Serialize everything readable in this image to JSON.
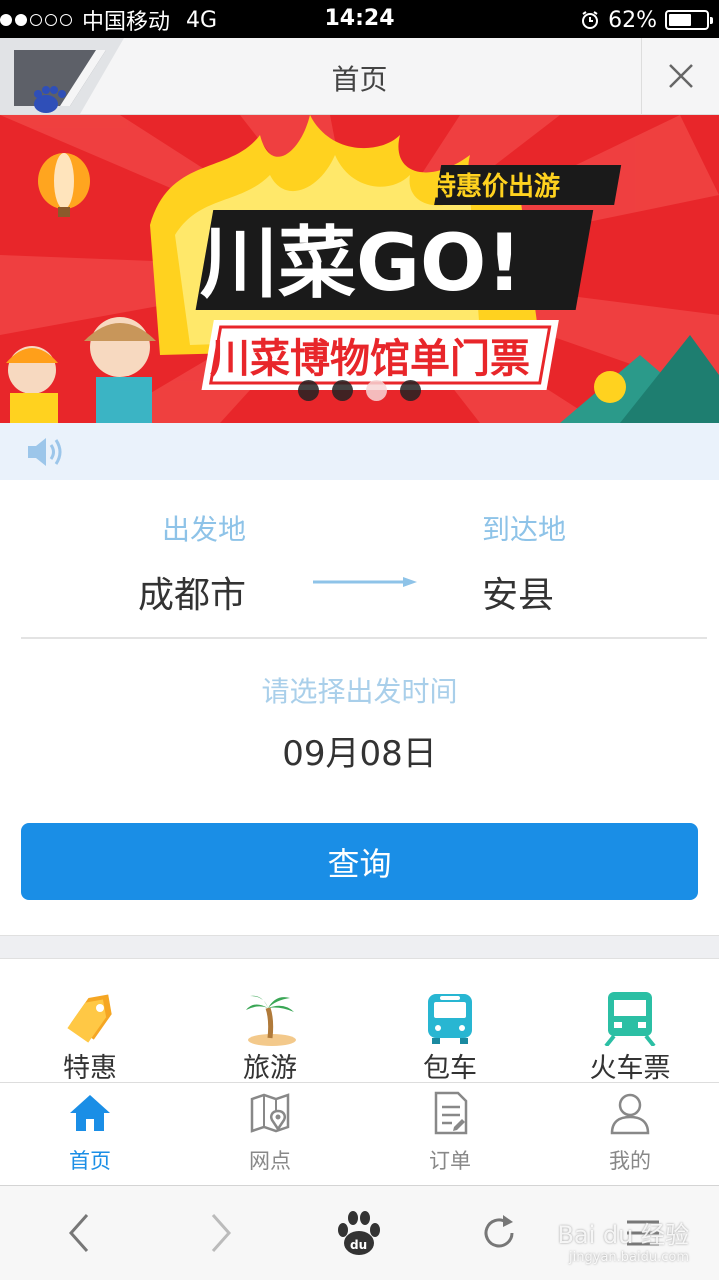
{
  "status_bar": {
    "carrier": "中国移动",
    "network": "4G",
    "time": "14:24",
    "battery": "62%",
    "battery_level": 0.62,
    "signal_bars": 2
  },
  "nav": {
    "title": "首页"
  },
  "banner": {
    "tagline": "特惠价出游",
    "headline": "川菜GO!",
    "subline": "川菜博物馆单门票",
    "slide_count": 4,
    "active_slide": 3
  },
  "search": {
    "from_label": "出发地",
    "from_city": "成都市",
    "to_label": "到达地",
    "to_city": "安县",
    "date_label": "请选择出发时间",
    "date_value": "09月08日",
    "query_button": "查询"
  },
  "categories": [
    {
      "label": "特惠",
      "icon": "tag-icon"
    },
    {
      "label": "旅游",
      "icon": "palm-tree-icon"
    },
    {
      "label": "包车",
      "icon": "bus-icon"
    },
    {
      "label": "火车票",
      "icon": "train-icon"
    }
  ],
  "tabs": [
    {
      "label": "首页",
      "icon": "home-icon",
      "active": true
    },
    {
      "label": "网点",
      "icon": "map-pin-icon",
      "active": false
    },
    {
      "label": "订单",
      "icon": "order-icon",
      "active": false
    },
    {
      "label": "我的",
      "icon": "user-icon",
      "active": false
    }
  ],
  "toolbar": {
    "icons": [
      "back-icon",
      "forward-icon",
      "baidu-paw-icon",
      "refresh-icon",
      "menu-icon"
    ]
  },
  "watermark": {
    "brand": "Bai du 经验",
    "url": "jingyan.baidu.com"
  },
  "colors": {
    "accent": "#1a8ee6",
    "label_light_blue": "#8ec3e8",
    "banner_red": "#e8262a",
    "banner_yellow": "#ffd21f"
  }
}
